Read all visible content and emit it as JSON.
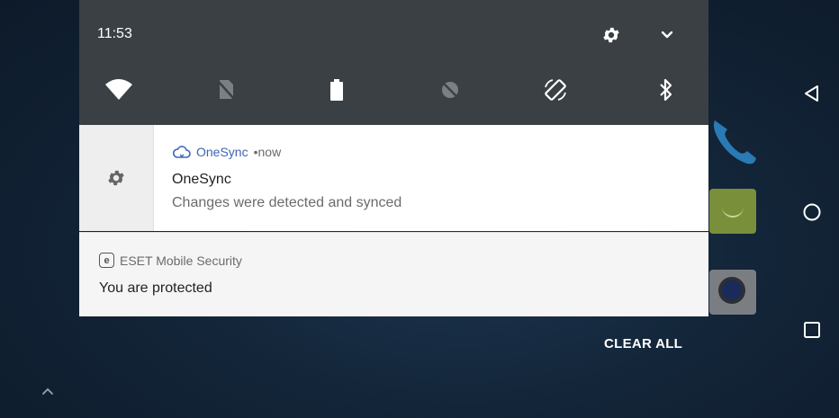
{
  "status": {
    "time": "11:53"
  },
  "quick_settings": {
    "tiles": [
      {
        "icon": "wifi-icon"
      },
      {
        "icon": "no-sim-icon"
      },
      {
        "icon": "battery-icon"
      },
      {
        "icon": "data-saver-off-icon"
      },
      {
        "icon": "auto-rotate-icon"
      },
      {
        "icon": "bluetooth-icon"
      }
    ]
  },
  "notifications": [
    {
      "app_name": "OneSync",
      "separator": " • ",
      "when": "now",
      "title": "OneSync",
      "text": "Changes were detected and synced",
      "icon": "cloud-sync-icon",
      "side_icon": "gear-icon"
    },
    {
      "badge_letter": "e",
      "app_name": "ESET Mobile Security",
      "text": "You are protected"
    }
  ],
  "actions": {
    "clear_all": "CLEAR ALL"
  },
  "colors": {
    "shade_header": "#3a4044",
    "accent_link": "#3c64b4",
    "card": "#ffffff"
  }
}
